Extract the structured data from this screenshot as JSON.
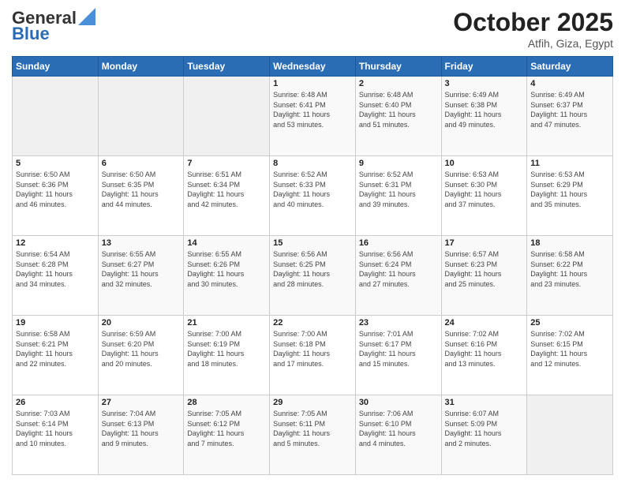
{
  "header": {
    "logo_line1": "General",
    "logo_line2": "Blue",
    "month": "October 2025",
    "location": "Atfih, Giza, Egypt"
  },
  "weekdays": [
    "Sunday",
    "Monday",
    "Tuesday",
    "Wednesday",
    "Thursday",
    "Friday",
    "Saturday"
  ],
  "weeks": [
    [
      {
        "day": "",
        "info": ""
      },
      {
        "day": "",
        "info": ""
      },
      {
        "day": "",
        "info": ""
      },
      {
        "day": "1",
        "info": "Sunrise: 6:48 AM\nSunset: 6:41 PM\nDaylight: 11 hours\nand 53 minutes."
      },
      {
        "day": "2",
        "info": "Sunrise: 6:48 AM\nSunset: 6:40 PM\nDaylight: 11 hours\nand 51 minutes."
      },
      {
        "day": "3",
        "info": "Sunrise: 6:49 AM\nSunset: 6:38 PM\nDaylight: 11 hours\nand 49 minutes."
      },
      {
        "day": "4",
        "info": "Sunrise: 6:49 AM\nSunset: 6:37 PM\nDaylight: 11 hours\nand 47 minutes."
      }
    ],
    [
      {
        "day": "5",
        "info": "Sunrise: 6:50 AM\nSunset: 6:36 PM\nDaylight: 11 hours\nand 46 minutes."
      },
      {
        "day": "6",
        "info": "Sunrise: 6:50 AM\nSunset: 6:35 PM\nDaylight: 11 hours\nand 44 minutes."
      },
      {
        "day": "7",
        "info": "Sunrise: 6:51 AM\nSunset: 6:34 PM\nDaylight: 11 hours\nand 42 minutes."
      },
      {
        "day": "8",
        "info": "Sunrise: 6:52 AM\nSunset: 6:33 PM\nDaylight: 11 hours\nand 40 minutes."
      },
      {
        "day": "9",
        "info": "Sunrise: 6:52 AM\nSunset: 6:31 PM\nDaylight: 11 hours\nand 39 minutes."
      },
      {
        "day": "10",
        "info": "Sunrise: 6:53 AM\nSunset: 6:30 PM\nDaylight: 11 hours\nand 37 minutes."
      },
      {
        "day": "11",
        "info": "Sunrise: 6:53 AM\nSunset: 6:29 PM\nDaylight: 11 hours\nand 35 minutes."
      }
    ],
    [
      {
        "day": "12",
        "info": "Sunrise: 6:54 AM\nSunset: 6:28 PM\nDaylight: 11 hours\nand 34 minutes."
      },
      {
        "day": "13",
        "info": "Sunrise: 6:55 AM\nSunset: 6:27 PM\nDaylight: 11 hours\nand 32 minutes."
      },
      {
        "day": "14",
        "info": "Sunrise: 6:55 AM\nSunset: 6:26 PM\nDaylight: 11 hours\nand 30 minutes."
      },
      {
        "day": "15",
        "info": "Sunrise: 6:56 AM\nSunset: 6:25 PM\nDaylight: 11 hours\nand 28 minutes."
      },
      {
        "day": "16",
        "info": "Sunrise: 6:56 AM\nSunset: 6:24 PM\nDaylight: 11 hours\nand 27 minutes."
      },
      {
        "day": "17",
        "info": "Sunrise: 6:57 AM\nSunset: 6:23 PM\nDaylight: 11 hours\nand 25 minutes."
      },
      {
        "day": "18",
        "info": "Sunrise: 6:58 AM\nSunset: 6:22 PM\nDaylight: 11 hours\nand 23 minutes."
      }
    ],
    [
      {
        "day": "19",
        "info": "Sunrise: 6:58 AM\nSunset: 6:21 PM\nDaylight: 11 hours\nand 22 minutes."
      },
      {
        "day": "20",
        "info": "Sunrise: 6:59 AM\nSunset: 6:20 PM\nDaylight: 11 hours\nand 20 minutes."
      },
      {
        "day": "21",
        "info": "Sunrise: 7:00 AM\nSunset: 6:19 PM\nDaylight: 11 hours\nand 18 minutes."
      },
      {
        "day": "22",
        "info": "Sunrise: 7:00 AM\nSunset: 6:18 PM\nDaylight: 11 hours\nand 17 minutes."
      },
      {
        "day": "23",
        "info": "Sunrise: 7:01 AM\nSunset: 6:17 PM\nDaylight: 11 hours\nand 15 minutes."
      },
      {
        "day": "24",
        "info": "Sunrise: 7:02 AM\nSunset: 6:16 PM\nDaylight: 11 hours\nand 13 minutes."
      },
      {
        "day": "25",
        "info": "Sunrise: 7:02 AM\nSunset: 6:15 PM\nDaylight: 11 hours\nand 12 minutes."
      }
    ],
    [
      {
        "day": "26",
        "info": "Sunrise: 7:03 AM\nSunset: 6:14 PM\nDaylight: 11 hours\nand 10 minutes."
      },
      {
        "day": "27",
        "info": "Sunrise: 7:04 AM\nSunset: 6:13 PM\nDaylight: 11 hours\nand 9 minutes."
      },
      {
        "day": "28",
        "info": "Sunrise: 7:05 AM\nSunset: 6:12 PM\nDaylight: 11 hours\nand 7 minutes."
      },
      {
        "day": "29",
        "info": "Sunrise: 7:05 AM\nSunset: 6:11 PM\nDaylight: 11 hours\nand 5 minutes."
      },
      {
        "day": "30",
        "info": "Sunrise: 7:06 AM\nSunset: 6:10 PM\nDaylight: 11 hours\nand 4 minutes."
      },
      {
        "day": "31",
        "info": "Sunrise: 6:07 AM\nSunset: 5:09 PM\nDaylight: 11 hours\nand 2 minutes."
      },
      {
        "day": "",
        "info": ""
      }
    ]
  ]
}
